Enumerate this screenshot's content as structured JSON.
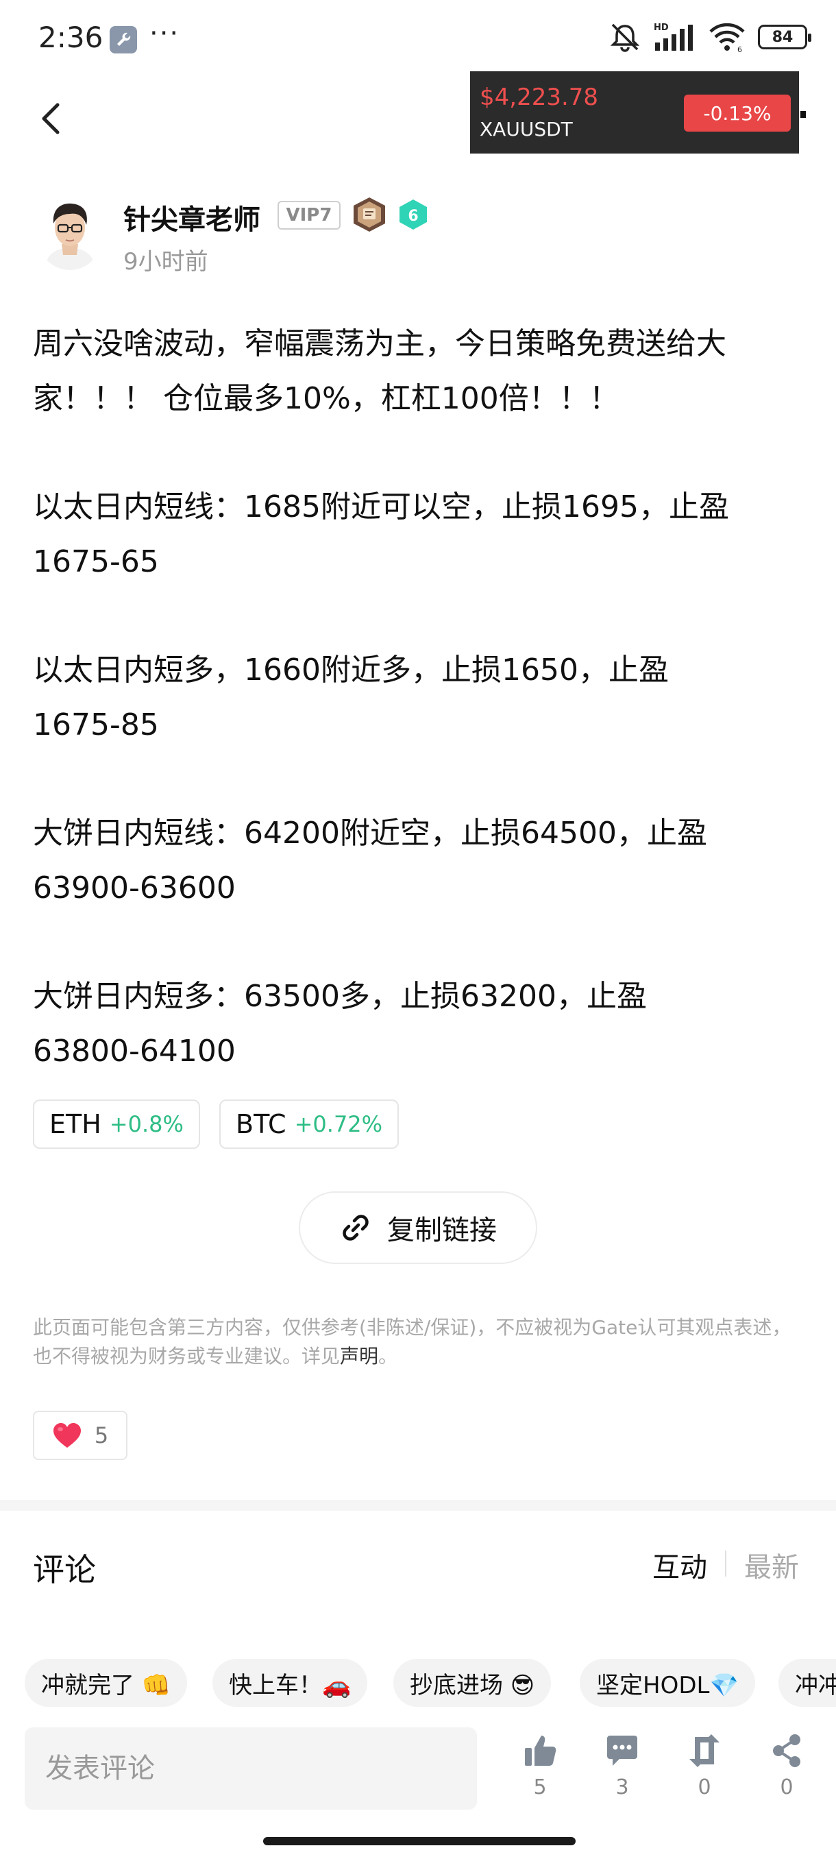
{
  "status_bar": {
    "time": "2:36",
    "dots": "···",
    "battery": "84",
    "icons": [
      "wrench-icon",
      "mute-icon",
      "signal-icon",
      "wifi-icon",
      "battery-icon"
    ]
  },
  "header": {
    "back_icon": "chevron-left-icon",
    "ticker": {
      "price": "$4,223.78",
      "symbol": "XAUUSDT",
      "change": "-0.13%",
      "price_color": "#ef4f4f",
      "change_bg": "#e94648"
    }
  },
  "author": {
    "name": "针尖章老师",
    "vip": "VIP7",
    "level": "6",
    "time": "9小时前"
  },
  "post": {
    "lines": [
      "周六没啥波动，窄幅震荡为主，今日策略免费送给大",
      "家！！！ 仓位最多10%，杠杠100倍！！！",
      "以太日内短线：1685附近可以空，止损1695，止盈",
      "1675-65",
      "以太日内短多，1660附近多，止损1650，止盈",
      "1675-85",
      "大饼日内短线：64200附近空，止损64500，止盈",
      "63900-63600",
      "大饼日内短多：63500多，止损63200，止盈",
      "63800-64100"
    ]
  },
  "coins": [
    {
      "name": "ETH",
      "change": "+0.8%"
    },
    {
      "name": "BTC",
      "change": "+0.72%"
    }
  ],
  "positive_color": "#2ebd85",
  "copy_link": {
    "label": "复制链接"
  },
  "disclaimer": {
    "text": "此页面可能包含第三方内容，仅供参考(非陈述/保证)，不应被视为Gate认可其观点表述，也不得被视为财务或专业建议。详见",
    "link": "声明",
    "end": "。"
  },
  "likes": {
    "count": "5"
  },
  "comments": {
    "title": "评论",
    "tab_interact": "互动",
    "tab_latest": "最新"
  },
  "chips": [
    "冲就完了 👊",
    "快上车！🚗",
    "抄底进场 😎",
    "坚定HODL💎",
    "冲冲冲"
  ],
  "bottom": {
    "placeholder": "发表评论",
    "actions": [
      {
        "icon": "thumbs-up-icon",
        "count": "5"
      },
      {
        "icon": "comment-icon",
        "count": "3"
      },
      {
        "icon": "repost-icon",
        "count": "0"
      },
      {
        "icon": "share-icon",
        "count": "0"
      }
    ]
  }
}
